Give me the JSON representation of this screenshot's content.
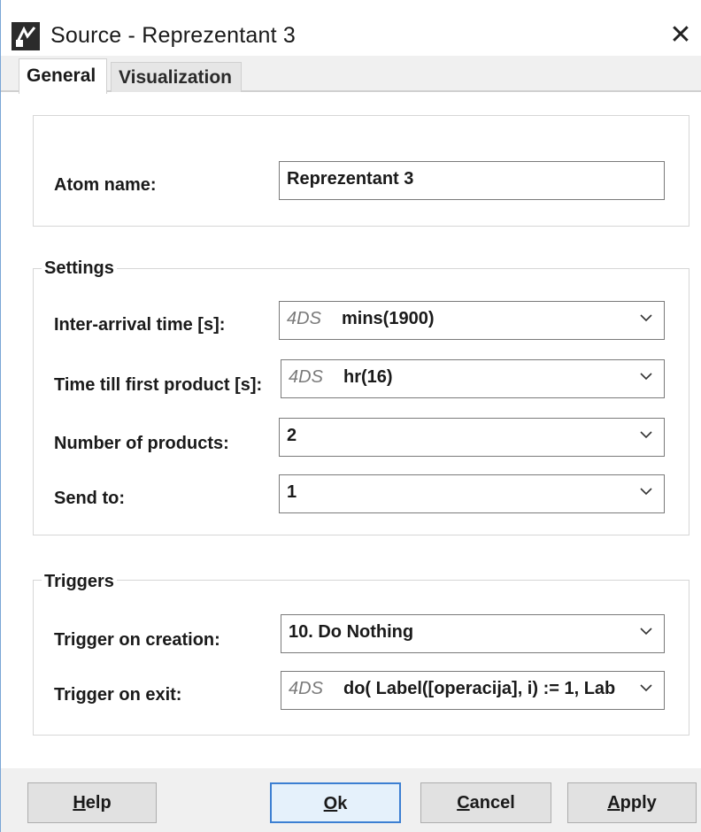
{
  "window": {
    "title": "Source - Reprezentant 3",
    "close_glyph": "✕",
    "icon": "source-app-icon"
  },
  "tabs": [
    {
      "label": "General",
      "selected": true
    },
    {
      "label": "Visualization",
      "selected": false
    }
  ],
  "atom": {
    "label": "Atom name:",
    "value": "Reprezentant 3"
  },
  "settings": {
    "title": "Settings",
    "fields": [
      {
        "label": "Inter-arrival time [s]:",
        "prefix": "4DS",
        "value": "mins(1900)"
      },
      {
        "label": "Time till first product [s]:",
        "prefix": "4DS",
        "value": "hr(16)"
      },
      {
        "label": "Number of products:",
        "prefix": "",
        "value": "2"
      },
      {
        "label": "Send to:",
        "prefix": "",
        "value": "1"
      }
    ]
  },
  "triggers": {
    "title": "Triggers",
    "fields": [
      {
        "label": "Trigger on creation:",
        "prefix": "",
        "value": "10. Do Nothing"
      },
      {
        "label": "Trigger on exit:",
        "prefix": "4DS",
        "value": "do( Label([operacija], i) := 1, Lab"
      }
    ]
  },
  "buttons": {
    "help": {
      "mnemonic": "H",
      "rest": "elp"
    },
    "ok": {
      "mnemonic": "O",
      "rest": "k"
    },
    "cancel": {
      "mnemonic": "C",
      "rest": "ancel"
    },
    "apply": {
      "mnemonic": "A",
      "rest": "pply"
    }
  },
  "colors": {
    "accent": "#3c7fd2",
    "window_bg": "#f0f0f0",
    "prefix_gray": "#7a7a7a"
  }
}
